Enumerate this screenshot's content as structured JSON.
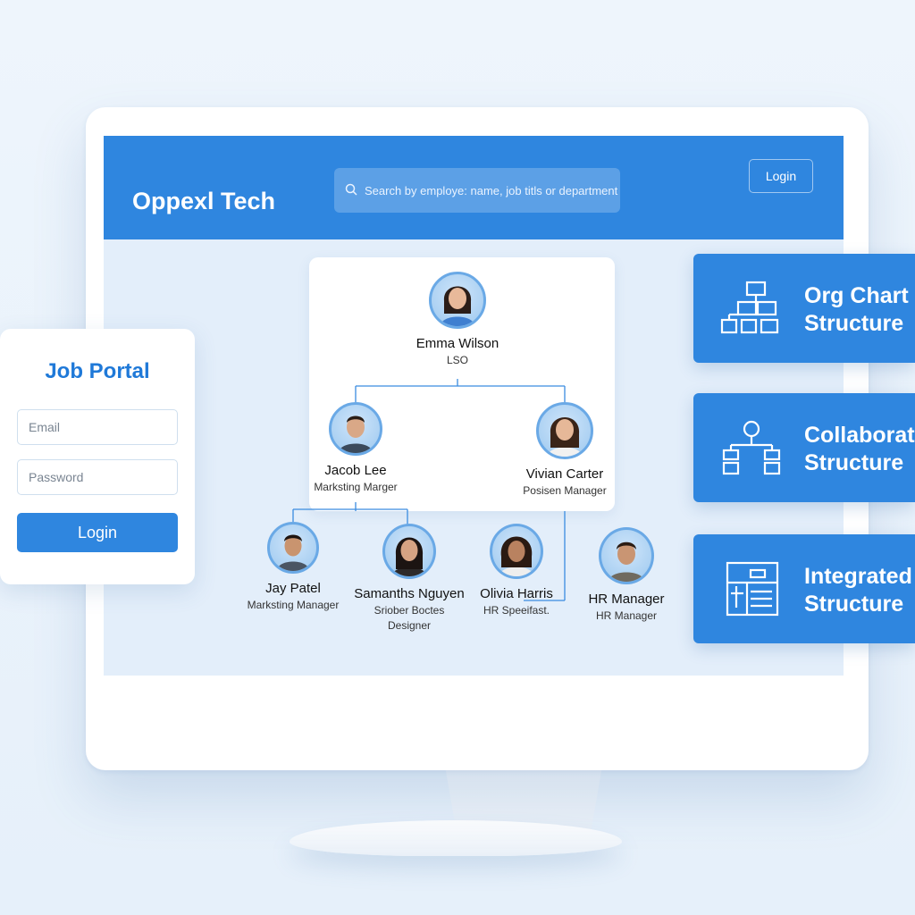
{
  "app": {
    "brand": "Oppexl Tech",
    "search_placeholder": "Search by employe: name, job titls or department",
    "login_label": "Login"
  },
  "org_chart": {
    "ceo": {
      "name": "Emma Wilson",
      "role": "LSO"
    },
    "level2": [
      {
        "name": "Jacob Lee",
        "role": "Marksting Marger"
      },
      {
        "name": "Vivian Carter",
        "role": "Posisen Manager"
      }
    ],
    "level3": [
      {
        "name": "Jay Patel",
        "role": "Marksting Manager"
      },
      {
        "name": "Samanths Nguyen",
        "role": "Sriober Boctes",
        "role2": "Designer"
      },
      {
        "name": "Olivia Harris",
        "role": "HR Speeifast."
      },
      {
        "name": "HR Manager",
        "role": "HR Manager"
      }
    ]
  },
  "job_portal": {
    "title": "Job Portal",
    "email_placeholder": "Email",
    "password_placeholder": "Password",
    "login_label": "Login"
  },
  "features": [
    {
      "line1": "Org Chart",
      "line2": "Structure",
      "icon": "org-chart-icon"
    },
    {
      "line1": "Collaborat",
      "line2": "Structure",
      "icon": "collaboration-icon"
    },
    {
      "line1": "Integrated",
      "line2": "Structure",
      "icon": "integrated-icon"
    }
  ],
  "colors": {
    "accent": "#2f86df",
    "background": "#e6f0fa",
    "title_blue": "#1f79d8"
  }
}
